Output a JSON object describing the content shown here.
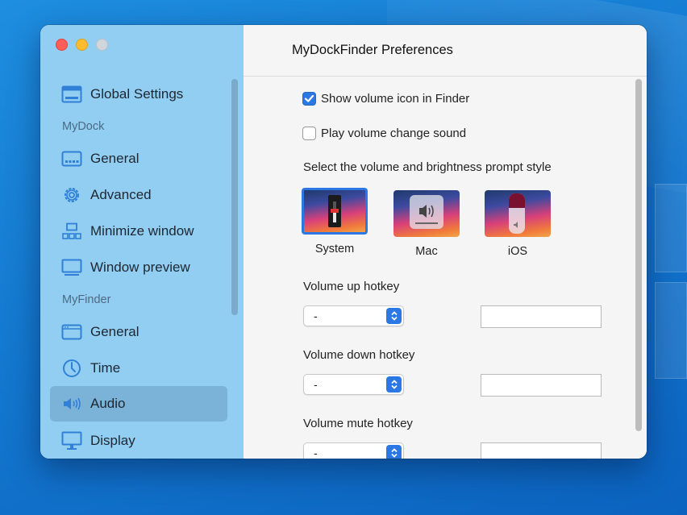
{
  "window": {
    "title": "MyDockFinder Preferences"
  },
  "sidebar": {
    "section_mydock": "MyDock",
    "section_myfinder": "MyFinder",
    "items": [
      {
        "label": "Global Settings",
        "icon": "window-icon"
      },
      {
        "label": "General",
        "icon": "dock-icon"
      },
      {
        "label": "Advanced",
        "icon": "gear-icon"
      },
      {
        "label": "Minimize window",
        "icon": "minimize-window-icon"
      },
      {
        "label": "Window preview",
        "icon": "window-preview-icon"
      },
      {
        "label": "General",
        "icon": "finder-window-icon"
      },
      {
        "label": "Time",
        "icon": "clock-icon"
      },
      {
        "label": "Audio",
        "icon": "speaker-icon",
        "active": true
      },
      {
        "label": "Display",
        "icon": "monitor-icon"
      }
    ]
  },
  "main": {
    "show_volume_icon": {
      "label": "Show volume icon in Finder",
      "checked": true
    },
    "play_change_sound": {
      "label": "Play volume change sound",
      "checked": false
    },
    "prompt_style_label": "Select the volume and brightness prompt style",
    "prompt_styles": [
      {
        "label": "System",
        "selected": true
      },
      {
        "label": "Mac",
        "selected": false
      },
      {
        "label": "iOS",
        "selected": false
      }
    ],
    "hotkeys": [
      {
        "label": "Volume up hotkey",
        "value": "-",
        "key": ""
      },
      {
        "label": "Volume down hotkey",
        "value": "-",
        "key": ""
      },
      {
        "label": "Volume mute hotkey",
        "value": "-",
        "key": ""
      }
    ]
  },
  "colors": {
    "accent": "#2b78e4",
    "sidebar_bg": "#92cef2",
    "desktop_bg": "#1479d0"
  }
}
